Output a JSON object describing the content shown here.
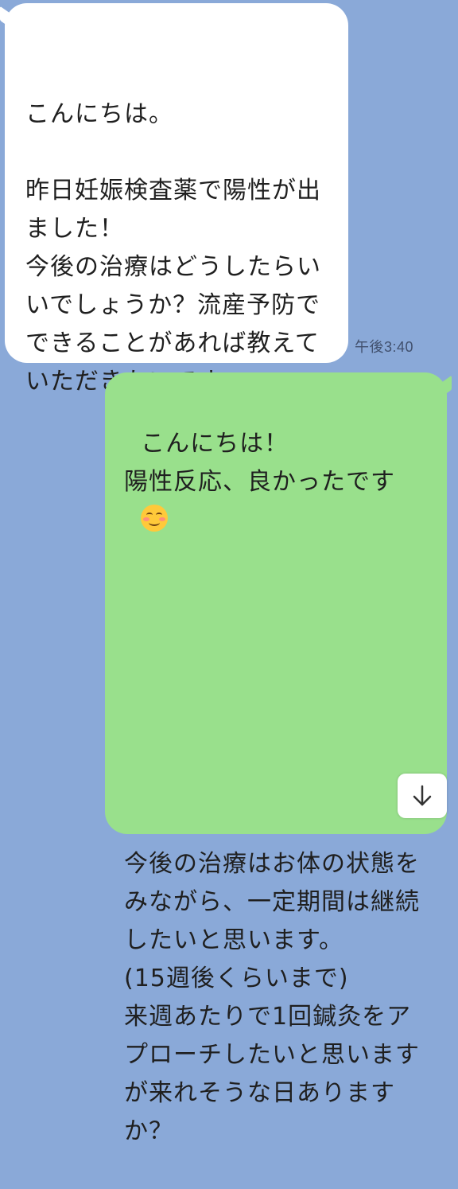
{
  "chat": {
    "incoming": {
      "text": "こんにちは。\n\n昨日妊娠検査薬で陽性が出ました！\n今後の治療はどうしたらいいでしょうか？流産予防でできることがあれば教えていただきたいです。",
      "timestamp": "午後3:40"
    },
    "outgoing": {
      "line1": "こんにちは！\n陽性反応、良かったです",
      "emoji": "smiling-face-with-smiling-eyes",
      "line2": "今後の治療はお体の状態をみながら、一定期間は継続したいと思います。\n(15週後くらいまで)\n来週あたりで1回鍼灸をアプローチしたいと思いますが来れそうな日ありますか？"
    }
  },
  "controls": {
    "scroll_down_icon": "arrow-down-icon"
  },
  "colors": {
    "background": "#8aa9d8",
    "incoming_bubble": "#ffffff",
    "outgoing_bubble": "#99e08c"
  }
}
